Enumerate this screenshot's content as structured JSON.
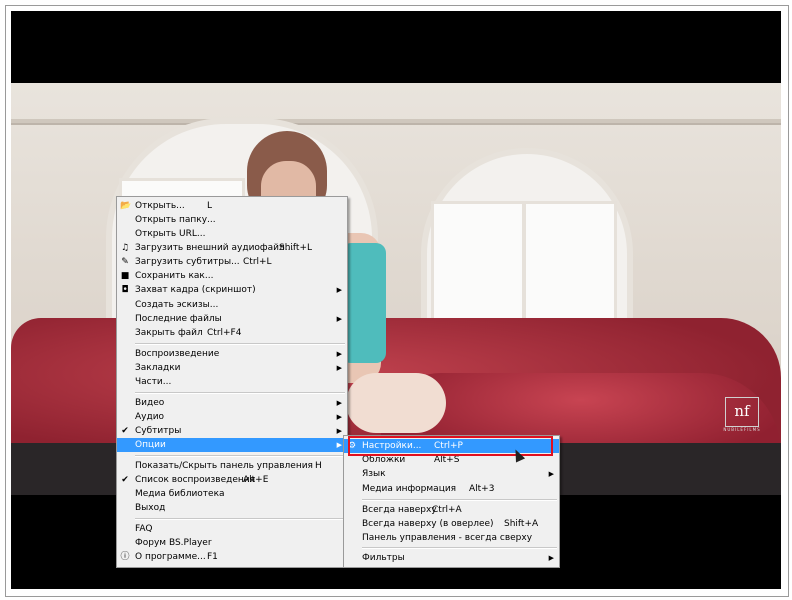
{
  "video": {
    "logo_text": "nf",
    "logo_sub": "NUBILEFILMS"
  },
  "main_menu": [
    {
      "label": "Открыть...",
      "shortcut": "L",
      "icon": "folder-icon"
    },
    {
      "label": "Открыть папку...",
      "shortcut": ""
    },
    {
      "label": "Открыть URL...",
      "shortcut": ""
    },
    {
      "label": "Загрузить внешний аудиофайл...",
      "shortcut": "Shift+L",
      "icon": "audio-file-icon"
    },
    {
      "label": "Загрузить субтитры...",
      "shortcut": "Ctrl+L",
      "icon": "pencil-icon"
    },
    {
      "label": "Сохранить как...",
      "shortcut": "",
      "icon": "floppy-icon"
    },
    {
      "label": "Захват кадра (скриншот)",
      "shortcut": "",
      "icon": "camera-icon",
      "submenu": true
    },
    {
      "label": "Создать эскизы...",
      "shortcut": ""
    },
    {
      "label": "Последние файлы",
      "shortcut": "",
      "submenu": true
    },
    {
      "label": "Закрыть файл",
      "shortcut": "Ctrl+F4"
    },
    {
      "label": "Воспроизведение",
      "shortcut": "",
      "submenu": true
    },
    {
      "label": "Закладки",
      "shortcut": "",
      "submenu": true
    },
    {
      "label": "Части...",
      "shortcut": ""
    },
    {
      "label": "Видео",
      "shortcut": "",
      "submenu": true
    },
    {
      "label": "Аудио",
      "shortcut": "",
      "submenu": true
    },
    {
      "label": "Субтитры",
      "shortcut": "",
      "icon": "check-icon",
      "submenu": true
    },
    {
      "label": "Опции",
      "shortcut": "",
      "submenu": true,
      "highlighted": true
    },
    {
      "label": "Показать/Скрыть панель управления",
      "shortcut": "H"
    },
    {
      "label": "Список воспроизведения",
      "shortcut": "Alt+E",
      "icon": "check-icon"
    },
    {
      "label": "Медиа библиотека",
      "shortcut": ""
    },
    {
      "label": "Выход",
      "shortcut": ""
    },
    {
      "label": "FAQ",
      "shortcut": ""
    },
    {
      "label": "Форум BS.Player",
      "shortcut": ""
    },
    {
      "label": "О программе...",
      "shortcut": "F1",
      "icon": "info-icon"
    }
  ],
  "options_menu": [
    {
      "label": "Настройки...",
      "shortcut": "Ctrl+P",
      "highlighted": true,
      "icon": "settings-icon"
    },
    {
      "label": "Обложки",
      "shortcut": "Alt+S"
    },
    {
      "label": "Язык",
      "shortcut": "",
      "submenu": true
    },
    {
      "label": "Медиа информация",
      "shortcut": "Alt+3"
    },
    {
      "label": "Всегда наверху",
      "shortcut": "Ctrl+A"
    },
    {
      "label": "Всегда наверху (в оверлее)",
      "shortcut": "Shift+A"
    },
    {
      "label": "Панель управления - всегда сверху",
      "shortcut": ""
    },
    {
      "label": "Фильтры",
      "shortcut": "",
      "submenu": true
    }
  ],
  "colors": {
    "highlight": "#3399ff",
    "annotation_box": "#e01020"
  }
}
